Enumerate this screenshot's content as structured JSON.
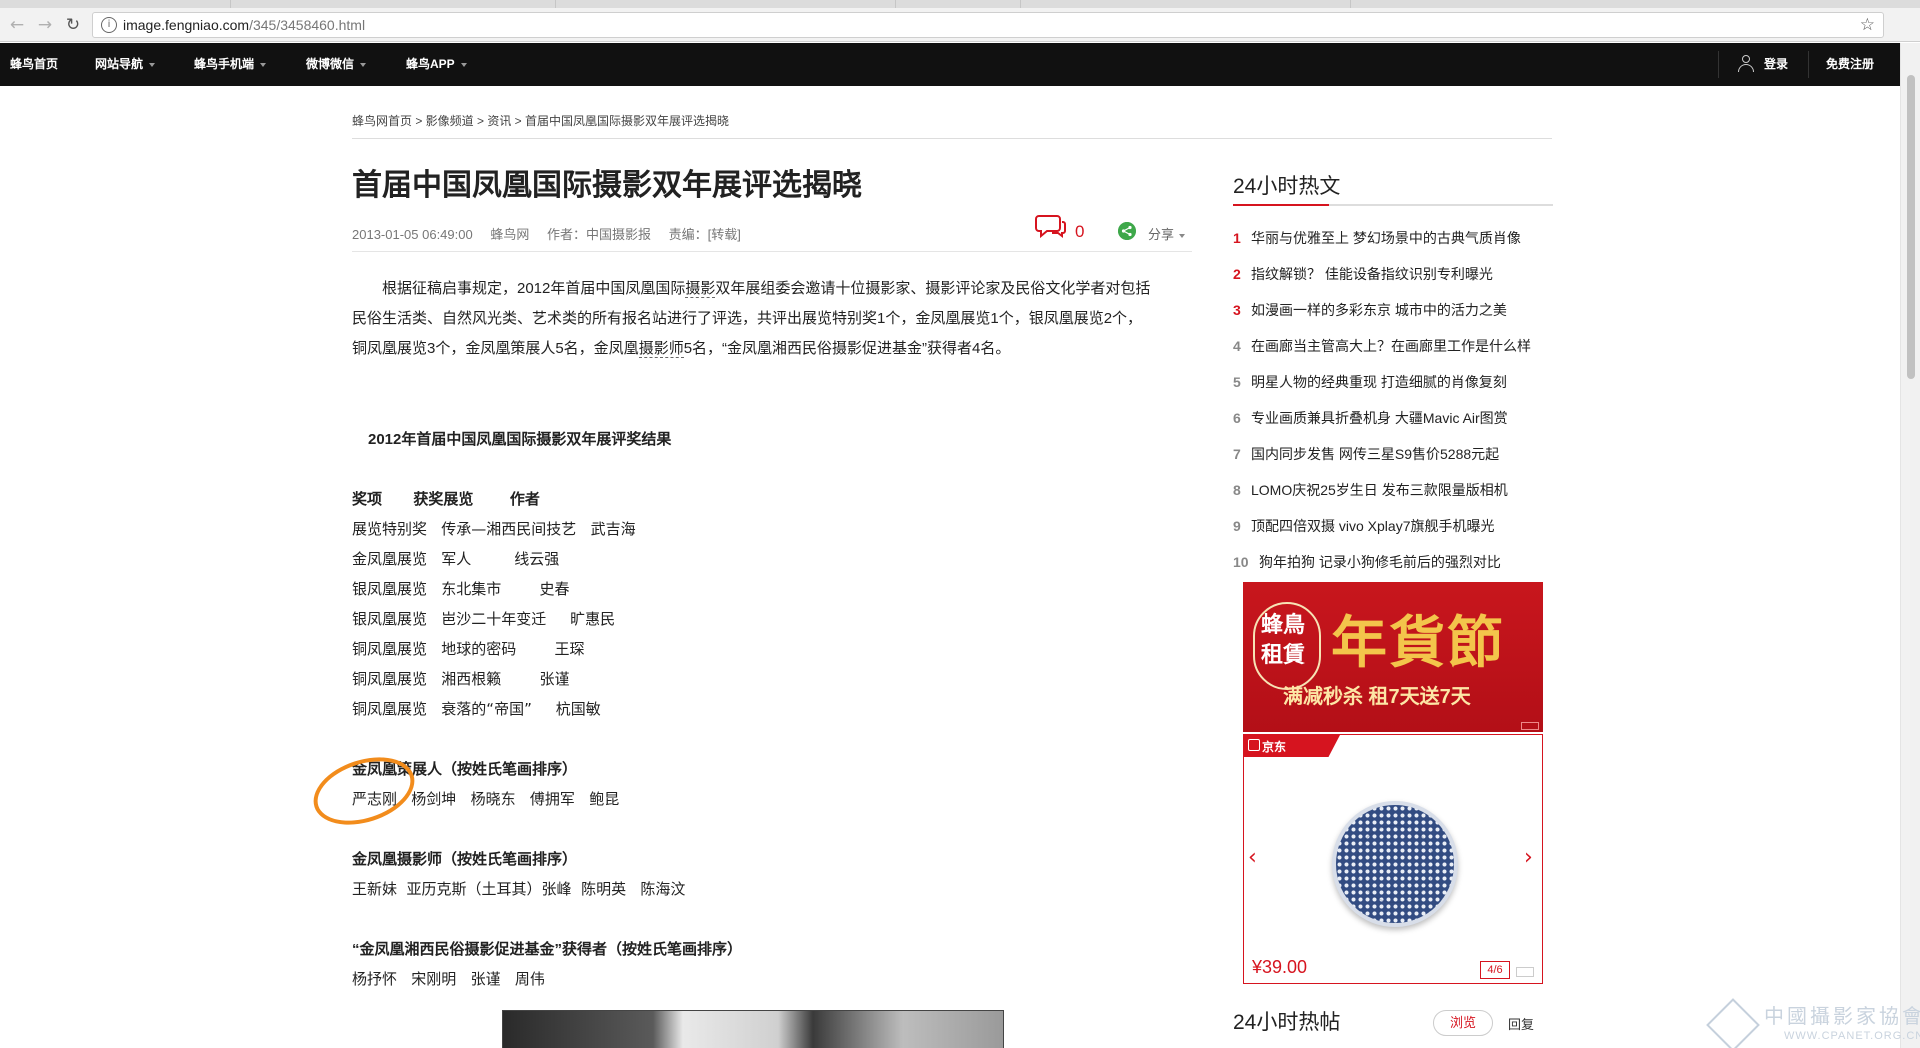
{
  "browser": {
    "url_host": "image.fengniao.com",
    "url_path": "/345/3458460.html"
  },
  "topnav": {
    "items": [
      "蜂鸟首页",
      "网站导航",
      "蜂鸟手机端",
      "微博微信",
      "蜂鸟APP"
    ],
    "login": "登录",
    "register": "免费注册"
  },
  "breadcrumb": "蜂鸟网首页 > 影像频道 > 资讯 > 首届中国凤凰国际摄影双年展评选揭晓",
  "article": {
    "title": "首届中国凤凰国际摄影双年展评选揭晓",
    "date": "2013-01-05 06:49:00",
    "source": "蜂鸟网",
    "author": "作者：中国摄影报",
    "editor": "责编：[转载]",
    "comment_count": "0",
    "share_label": "分享",
    "intro_1": "根据征稿启事规定，2012年首届中国凤凰国际",
    "intro_kw1": "摄影",
    "intro_2": "双年展组委会邀请十位摄影家、摄影评论家及民俗文化学者对包括民俗生活类、自然风光类、艺术类的所有报名站进行了评选，共评出展览特别奖1个，金凤凰展览1个，银凤凰展览2个，铜凤凰展览3个，金凤凰策展人5名，金凤凰",
    "intro_kw2": "摄影师",
    "intro_3": "5名，“金凤凰湘西民俗摄影促进基金”获得者4名。",
    "results_title": "2012年首届中国凤凰国际摄影双年展评奖结果",
    "table_header": "奖项      获奖展览       作者",
    "table_rows": [
      "展览特别奖   传承—湘西民间技艺   武吉海",
      "金凤凰展览   军人         线云强",
      "银凤凰展览   东北集市        史春",
      "银凤凰展览   岜沙二十年变迁     旷惠民",
      "铜凤凰展览   地球的密码        王琛",
      "铜凤凰展览   湘西根籁        张谨",
      "铜凤凰展览   衰落的“帝国”     杭国敏"
    ],
    "curators_title": "金凤凰策展人（按姓氏笔画排序）",
    "curators": "严志刚   杨剑坤   杨晓东   傅拥军   鲍昆",
    "photographers_title": "金凤凰摄影师（按姓氏笔画排序）",
    "photographers": "王新妹  亚历克斯（土耳其）张峰  陈明英   陈海汶",
    "fund_title": "“金凤凰湘西民俗摄影促进基金”获得者（按姓氏笔画排序）",
    "fund": "杨抒怀   宋刚明   张谨   周伟"
  },
  "sidebar": {
    "hot_title": "24小时热文",
    "hot_items": [
      {
        "num": "1",
        "text": "华丽与优雅至上 梦幻场景中的古典气质肖像"
      },
      {
        "num": "2",
        "text": "指纹解锁？ 佳能设备指纹识别专利曝光"
      },
      {
        "num": "3",
        "text": "如漫画一样的多彩东京 城市中的活力之美"
      },
      {
        "num": "4",
        "text": "在画廊当主管高大上？在画廊里工作是什么样"
      },
      {
        "num": "5",
        "text": "明星人物的经典重现 打造细腻的肖像复刻"
      },
      {
        "num": "6",
        "text": "专业画质兼具折叠机身 大疆Mavic Air图赏"
      },
      {
        "num": "7",
        "text": "国内同步发售 网传三星S9售价5288元起"
      },
      {
        "num": "8",
        "text": "LOMO庆祝25岁生日 发布三款限量版相机"
      },
      {
        "num": "9",
        "text": "顶配四倍双摄 vivo Xplay7旗舰手机曝光"
      },
      {
        "num": "10",
        "text": "狗年拍狗 记录小狗修毛前后的强烈对比"
      }
    ],
    "ad": {
      "seal_text": "蜂鳥租賃",
      "big_text": "年貨節",
      "sub_text": "满减秒杀 租7天送7天"
    },
    "product": {
      "tag": "京东",
      "price": "¥39.00",
      "pager": "4/6"
    },
    "post_title": "24小时热帖",
    "tab_browse": "浏览",
    "tab_reply": "回复"
  },
  "watermark": {
    "text": "中國攝影家協會",
    "url": "WWW.CPANET.ORG.CN"
  },
  "colors": {
    "accent_red": "#d6141f",
    "nav_bg": "#111111",
    "highlight_ring": "#f28c1c"
  }
}
